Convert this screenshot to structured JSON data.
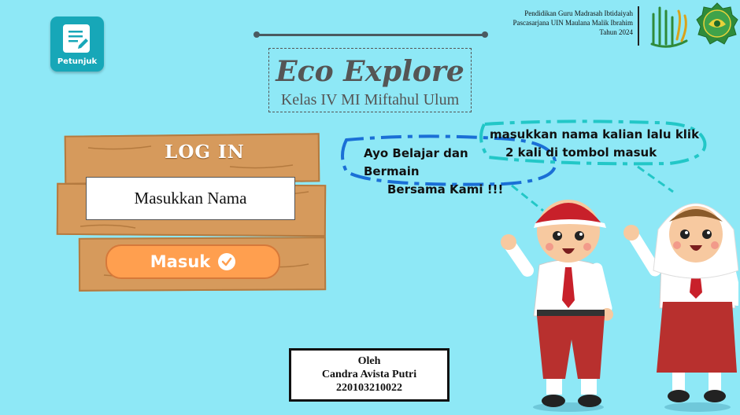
{
  "help": {
    "label": "Petunjuk",
    "icon": "document-edit-icon"
  },
  "institution": {
    "line1": "Pendidikan Guru Madrasah Ibtidaiyah",
    "line2": "Pascasarjana UIN Maulana Malik Ibrahim",
    "line3": "Tahun 2024",
    "logo1_icon": "arabic-calligraphy-logo",
    "logo2_icon": "green-seal-logo"
  },
  "title": {
    "main": "Eco Explore",
    "sub": "Kelas IV MI Miftahul Ulum"
  },
  "login": {
    "heading": "LOG IN",
    "name_placeholder": "Masukkan Nama",
    "submit_label": "Masuk",
    "submit_icon": "check-circle-icon"
  },
  "speech": {
    "boy_line1": "Ayo Belajar dan Bermain",
    "boy_line2": "Bersama Kami !!!",
    "girl_line1": "masukkan nama kalian lalu klik",
    "girl_line2": "2 kali di tombol masuk"
  },
  "author": {
    "by": "Oleh",
    "name": "Candra Avista Putri",
    "id": "220103210022"
  },
  "colors": {
    "background": "#8ee8f6",
    "wood": "#d69a5c",
    "button": "#ff9f4f",
    "help": "#17a7b8",
    "bubble_blue": "#1a6fd6",
    "bubble_teal": "#22c7c7"
  }
}
